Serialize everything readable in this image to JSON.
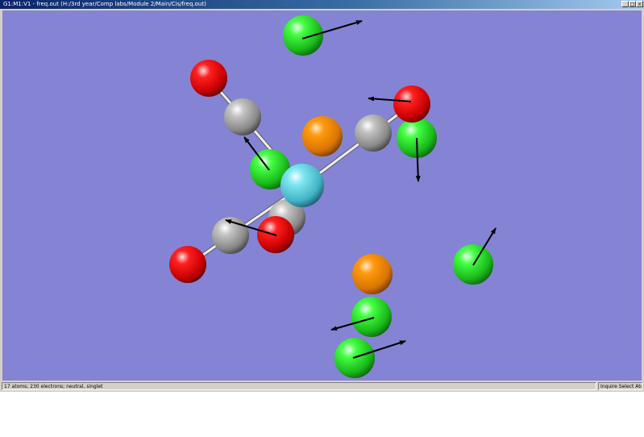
{
  "window": {
    "title": "G1:M1:V1 - freq.out (H:/3rd year/Comp labs/Module 2/Main/Cis/freq.out)",
    "controls": {
      "minimize": "_",
      "maximize": "□",
      "close": "×"
    }
  },
  "viewport": {
    "background_color": "#8583d4",
    "atom_colors": {
      "chlorine": "#22dd22",
      "oxygen": "#ee0000",
      "carbon": "#9a9a9a",
      "metal": "#55c8d8",
      "phosphorus": "#ee8800"
    }
  },
  "status": {
    "left": "17 atoms; 230 electrons; neutral, singlet",
    "right": "Inquire Select Atom 1"
  }
}
